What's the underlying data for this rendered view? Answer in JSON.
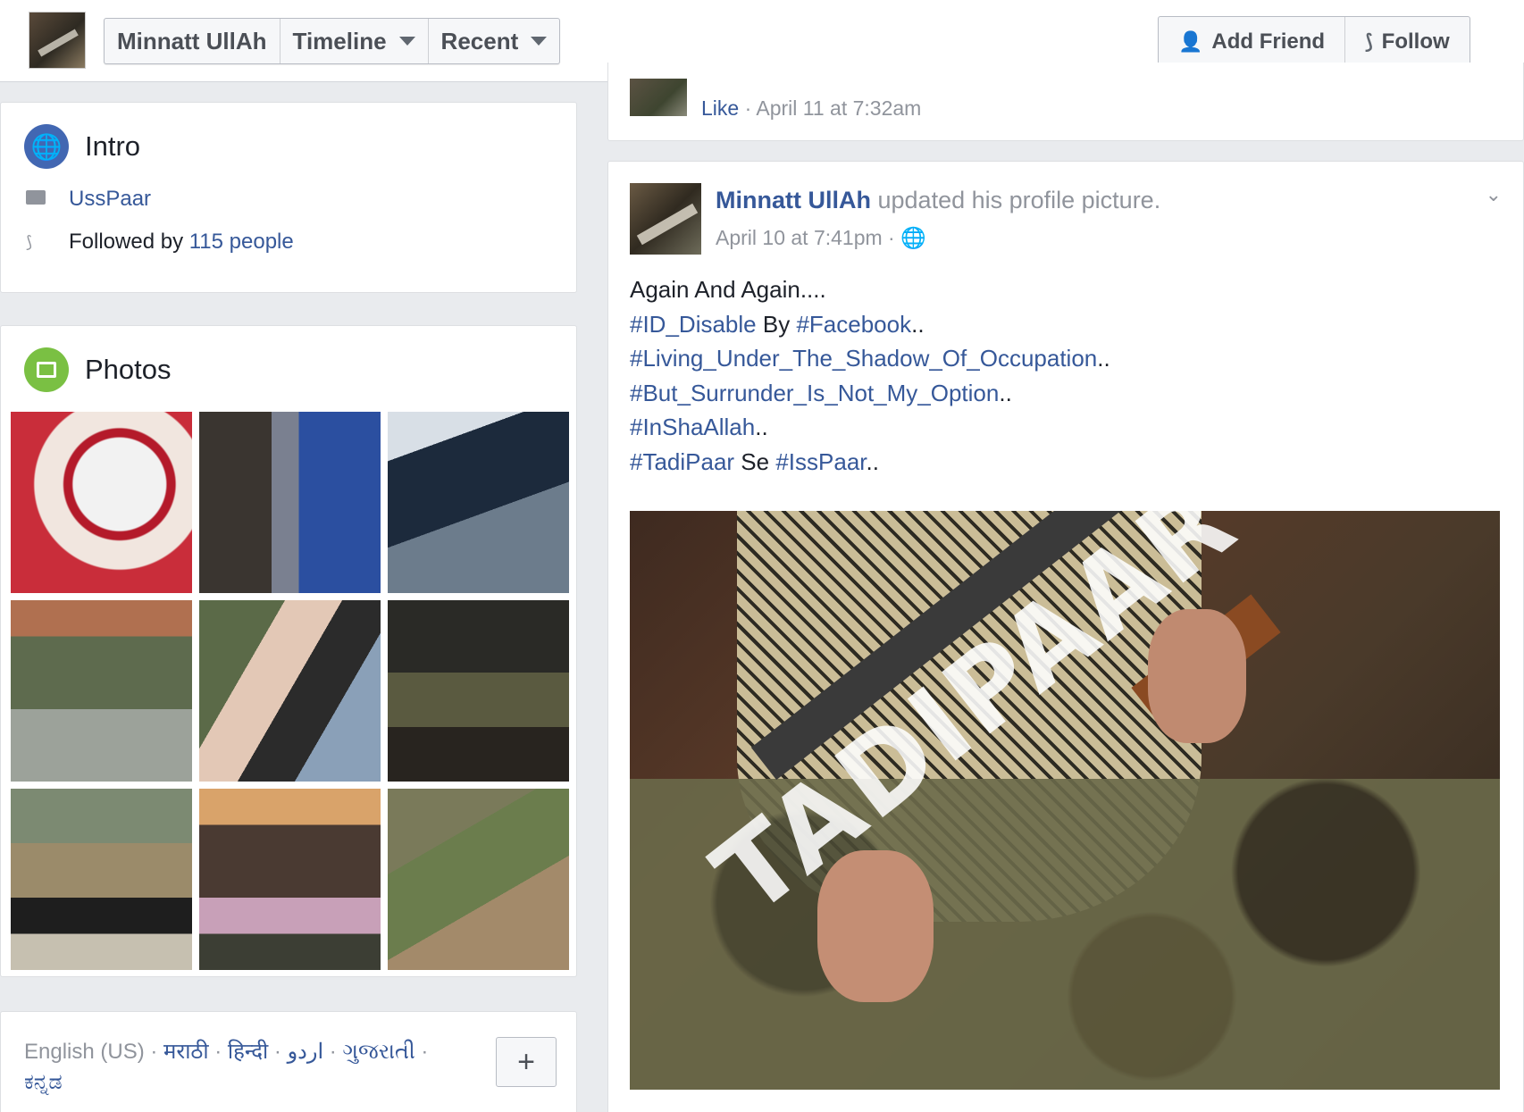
{
  "header": {
    "breadcrumbs": [
      {
        "label": "Minnatt UllAh"
      },
      {
        "label": "Timeline"
      },
      {
        "label": "Recent"
      }
    ],
    "add_friend_label": "Add Friend",
    "follow_label": "Follow"
  },
  "intro": {
    "title": "Intro",
    "work": "UssPaar",
    "followed_prefix": "Followed by",
    "followers_link": "115 people"
  },
  "photos": {
    "title": "Photos"
  },
  "footer": {
    "current_language": "English (US)",
    "languages": [
      "मराठी",
      "हिन्दी",
      "اردو",
      "ગુજરાતી",
      "ಕನ್ನಡ"
    ],
    "more_label": "+"
  },
  "previous_post": {
    "like_label": "Like",
    "timestamp": "April 11 at 7:32am"
  },
  "post": {
    "author": "Minnatt UllAh",
    "action": "updated his profile picture.",
    "timestamp": "April 10 at 7:41pm",
    "lines": {
      "l1": "Again And Again....",
      "l2_tag1": "#ID_Disable",
      "l2_mid": " By ",
      "l2_tag2": "#Facebook",
      "l2_end": "..",
      "l3_tag": "#Living_Under_The_Shadow_Of_Occupation",
      "l3_end": "..",
      "l4_tag": "#But_Surrunder_Is_Not_My_Option",
      "l4_end": "..",
      "l5_tag": "#InShaAllah",
      "l5_end": "..",
      "l6_tag1": "#TadiPaar",
      "l6_mid": " Se ",
      "l6_tag2": "#IssPaar",
      "l6_end": ".."
    },
    "image_watermark": "TADIPAAR"
  }
}
